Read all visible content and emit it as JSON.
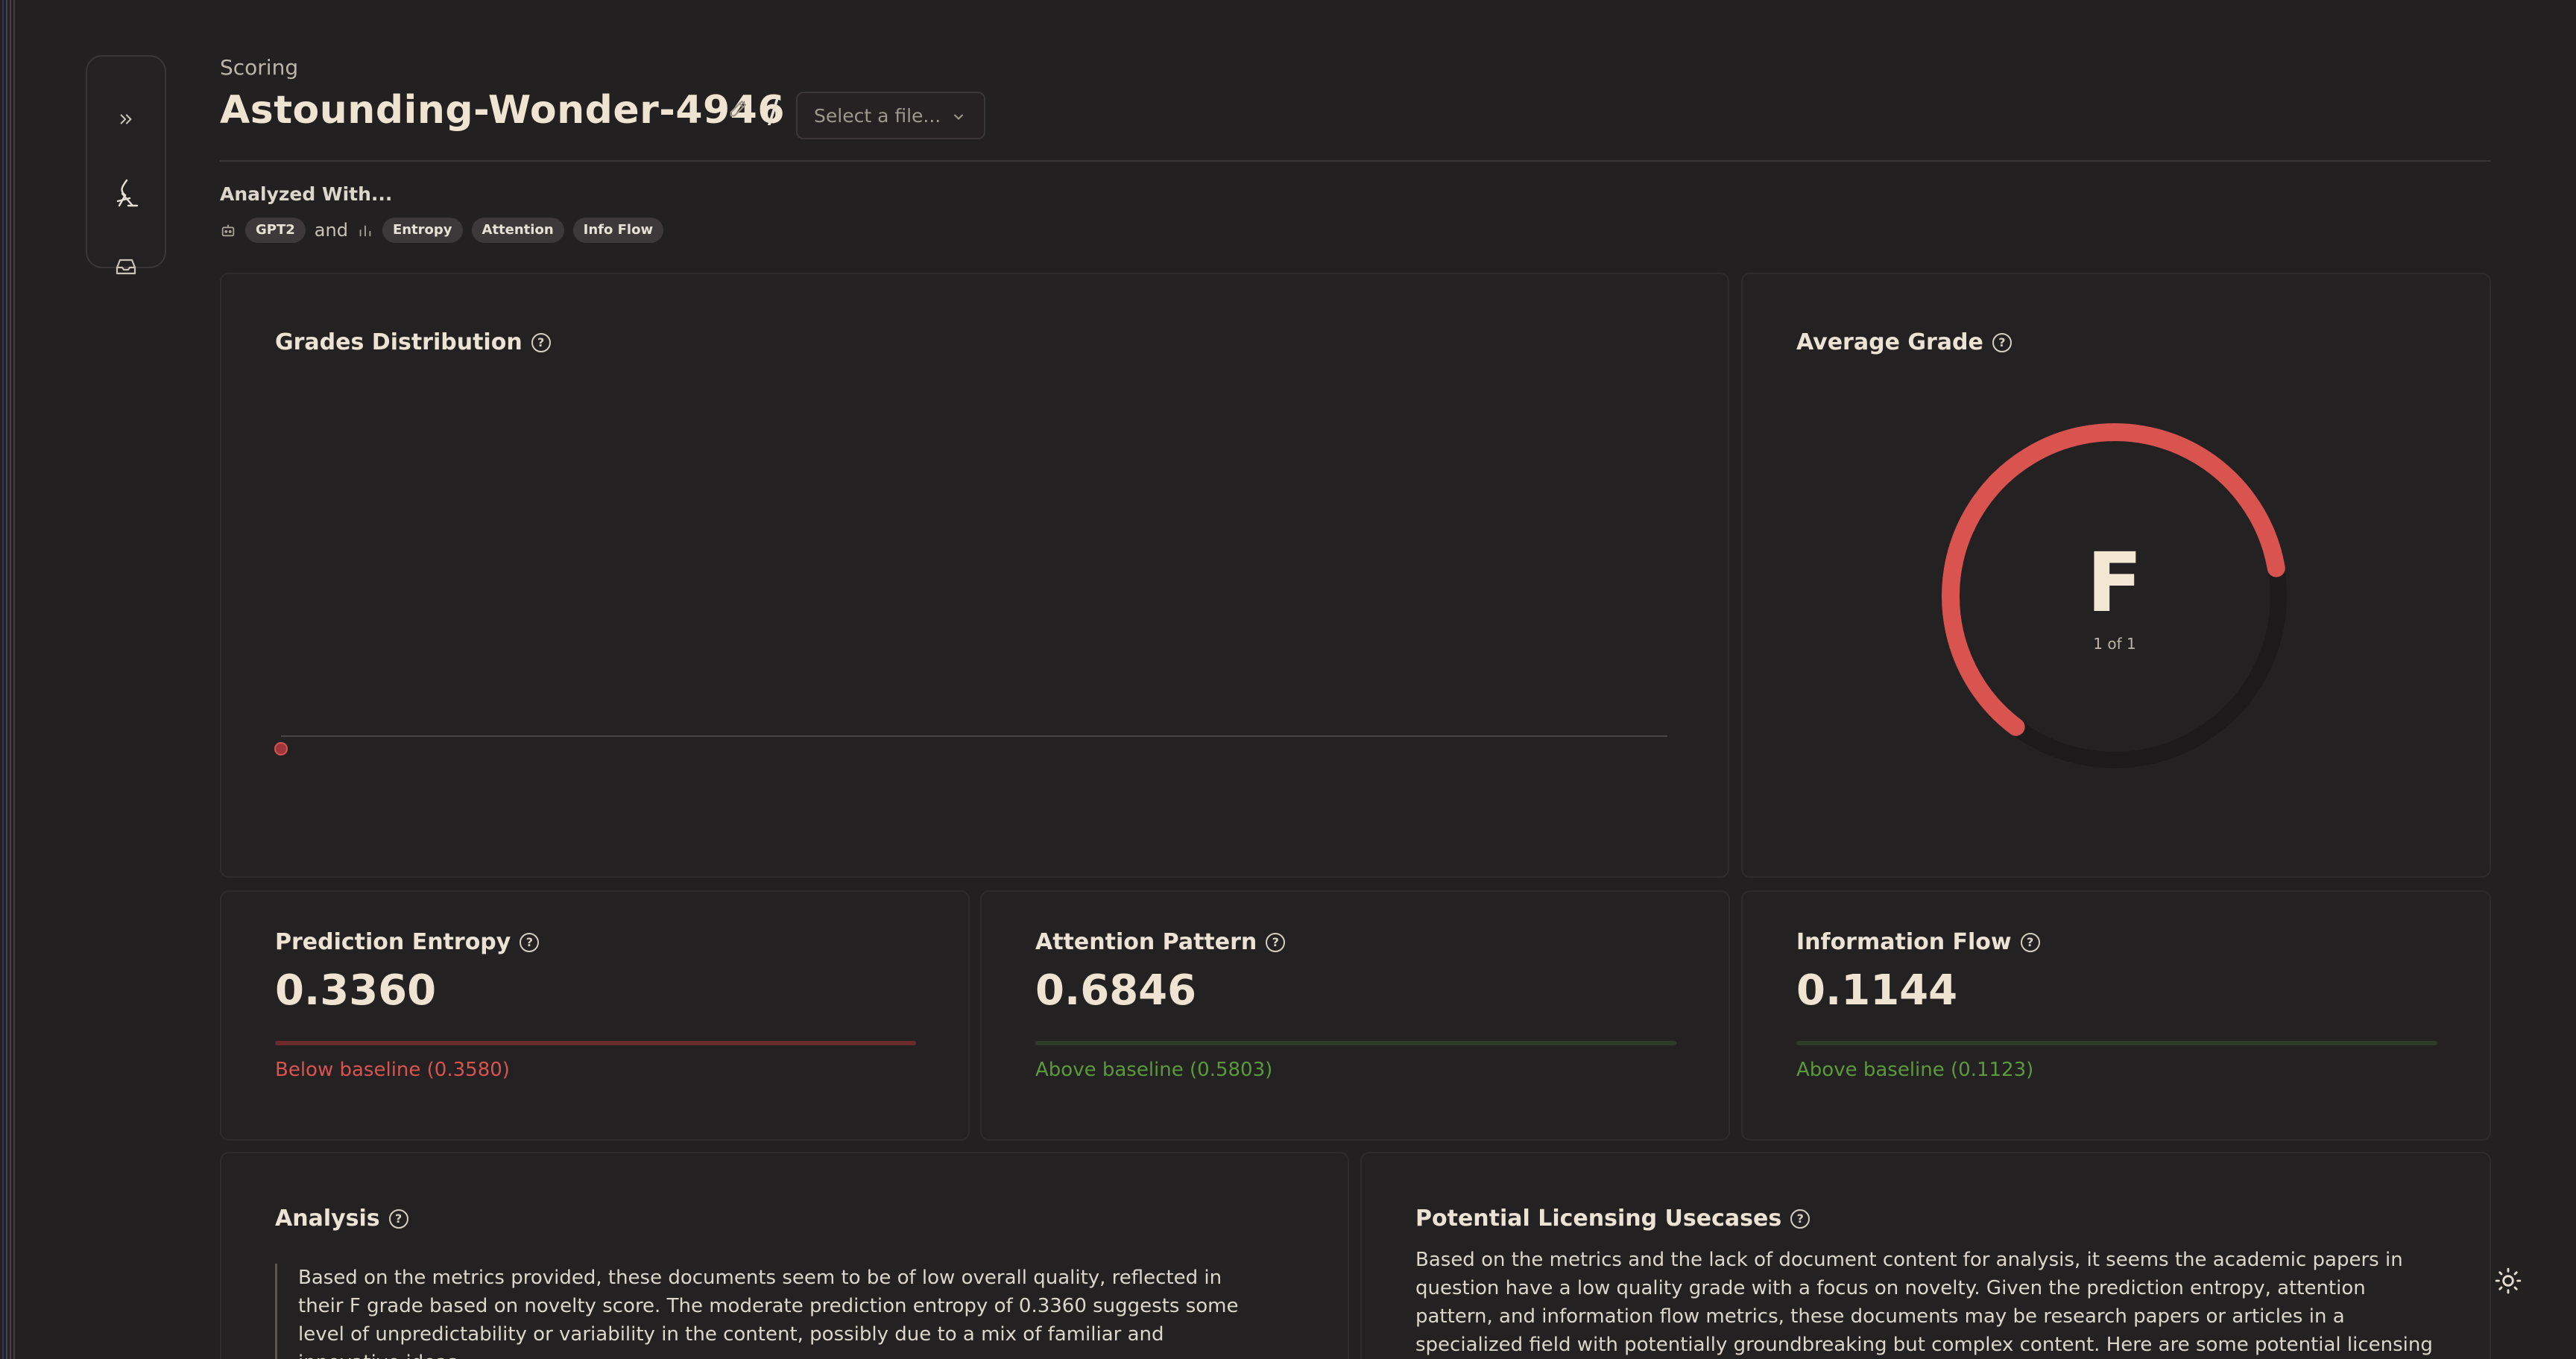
{
  "colors": {
    "background": "#232021",
    "card": "#242122",
    "accent_red": "#d9534f",
    "accent_green": "#5a9a3c",
    "text": "#ece6dc"
  },
  "header": {
    "breadcrumb": "Scoring",
    "title": "Astounding-Wonder-4946",
    "separator": "/",
    "file_select": "Select a file..."
  },
  "analyzed": {
    "label": "Analyzed With...",
    "model": "GPT2",
    "conjunction": "and",
    "metrics": [
      "Entropy",
      "Attention",
      "Info Flow"
    ]
  },
  "grades_distribution": {
    "title": "Grades Distribution"
  },
  "chart_data": {
    "type": "line",
    "title": "Grades Distribution",
    "x": [
      0
    ],
    "series": [
      {
        "values": [
          0
        ]
      }
    ]
  },
  "average_grade": {
    "title": "Average Grade",
    "grade": "F",
    "position": "1 of 1",
    "fraction": 0.62
  },
  "metrics": [
    {
      "title": "Prediction Entropy",
      "value": "0.3360",
      "note": "Below baseline (0.3580)",
      "status": "below"
    },
    {
      "title": "Attention Pattern",
      "value": "0.6846",
      "note": "Above baseline (0.5803)",
      "status": "above"
    },
    {
      "title": "Information Flow",
      "value": "0.1144",
      "note": "Above baseline (0.1123)",
      "status": "above"
    }
  ],
  "analysis": {
    "title": "Analysis",
    "text": "Based on the metrics provided, these documents seem to be of low overall quality, reflected in their F grade based on novelty score. The moderate prediction entropy of 0.3360 suggests some level of unpredictability or variability in the content, possibly due to a mix of familiar and innovative ideas."
  },
  "licensing": {
    "title": "Potential Licensing Usecases",
    "text": "Based on the metrics and the lack of document content for analysis, it seems the academic papers in question have a low quality grade with a focus on novelty. Given the prediction entropy, attention pattern, and information flow metrics, these documents may be research papers or articles in a specialized field with potentially groundbreaking but complex content. Here are some potential licensing use cases based on"
  },
  "icons": {
    "expand": "chevrons-right-icon",
    "scoring": "scoring-tool-icon",
    "inbox": "inbox-icon",
    "edit": "pencil-icon",
    "robot": "robot-icon",
    "chart": "bar-chart-icon",
    "help": "help-circle-icon",
    "theme": "sun-icon"
  }
}
